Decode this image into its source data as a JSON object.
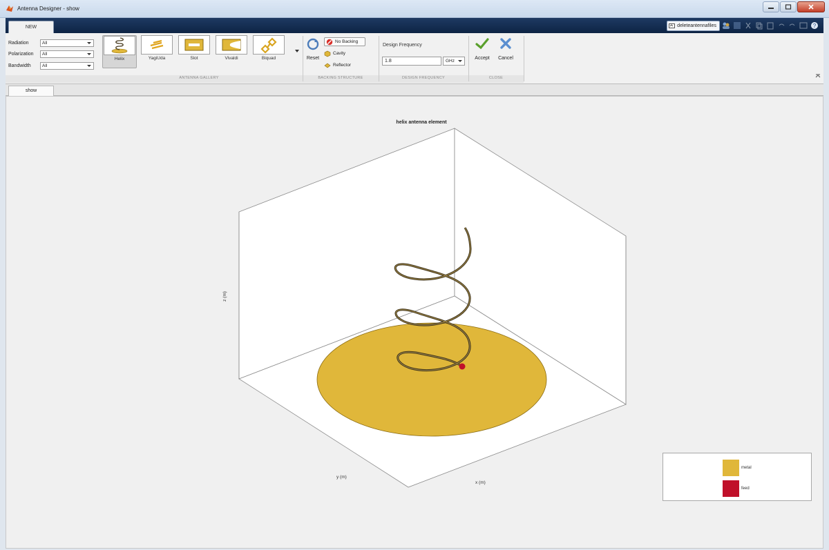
{
  "window": {
    "title": "Antenna Designer - show"
  },
  "toolstrip": {
    "tab_new": "NEW",
    "qat_field": "deleteantennafiles"
  },
  "filters": [
    {
      "label": "Radiation",
      "value": "All"
    },
    {
      "label": "Polarization",
      "value": "All"
    },
    {
      "label": "Bandwidth",
      "value": "All"
    }
  ],
  "gallery": {
    "items": [
      "Helix",
      "YagiUda",
      "Slot",
      "Vivaldi",
      "Biquad"
    ],
    "selected": "Helix",
    "section_label": "ANTENNA GALLERY"
  },
  "reset": {
    "label": "Reset"
  },
  "backing": {
    "items": [
      "No Backing",
      "Cavity",
      "Reflector"
    ],
    "selected": "No Backing",
    "section_label": "BACKING STRUCTURE"
  },
  "design_frequency": {
    "title": "Design Frequency",
    "value": "1.8",
    "unit": "GHz",
    "section_label": "DESIGN FREQUENCY"
  },
  "close": {
    "accept": "Accept",
    "cancel": "Cancel",
    "section_label": "CLOSE"
  },
  "document": {
    "tab": "show"
  },
  "plot": {
    "title": "helix antenna element",
    "xlabel": "x (m)",
    "ylabel": "y (m)",
    "zlabel": "z (m)",
    "legend": [
      {
        "label": "metal",
        "color": "#e0b73a"
      },
      {
        "label": "feed",
        "color": "#c0102a"
      }
    ]
  },
  "colors": {
    "metal": "#e0b73a",
    "feed": "#c0102a",
    "helix": "#4a3d22",
    "ribbon_bg": "#f1f1f1",
    "tabstrip": "#1e3a62"
  }
}
